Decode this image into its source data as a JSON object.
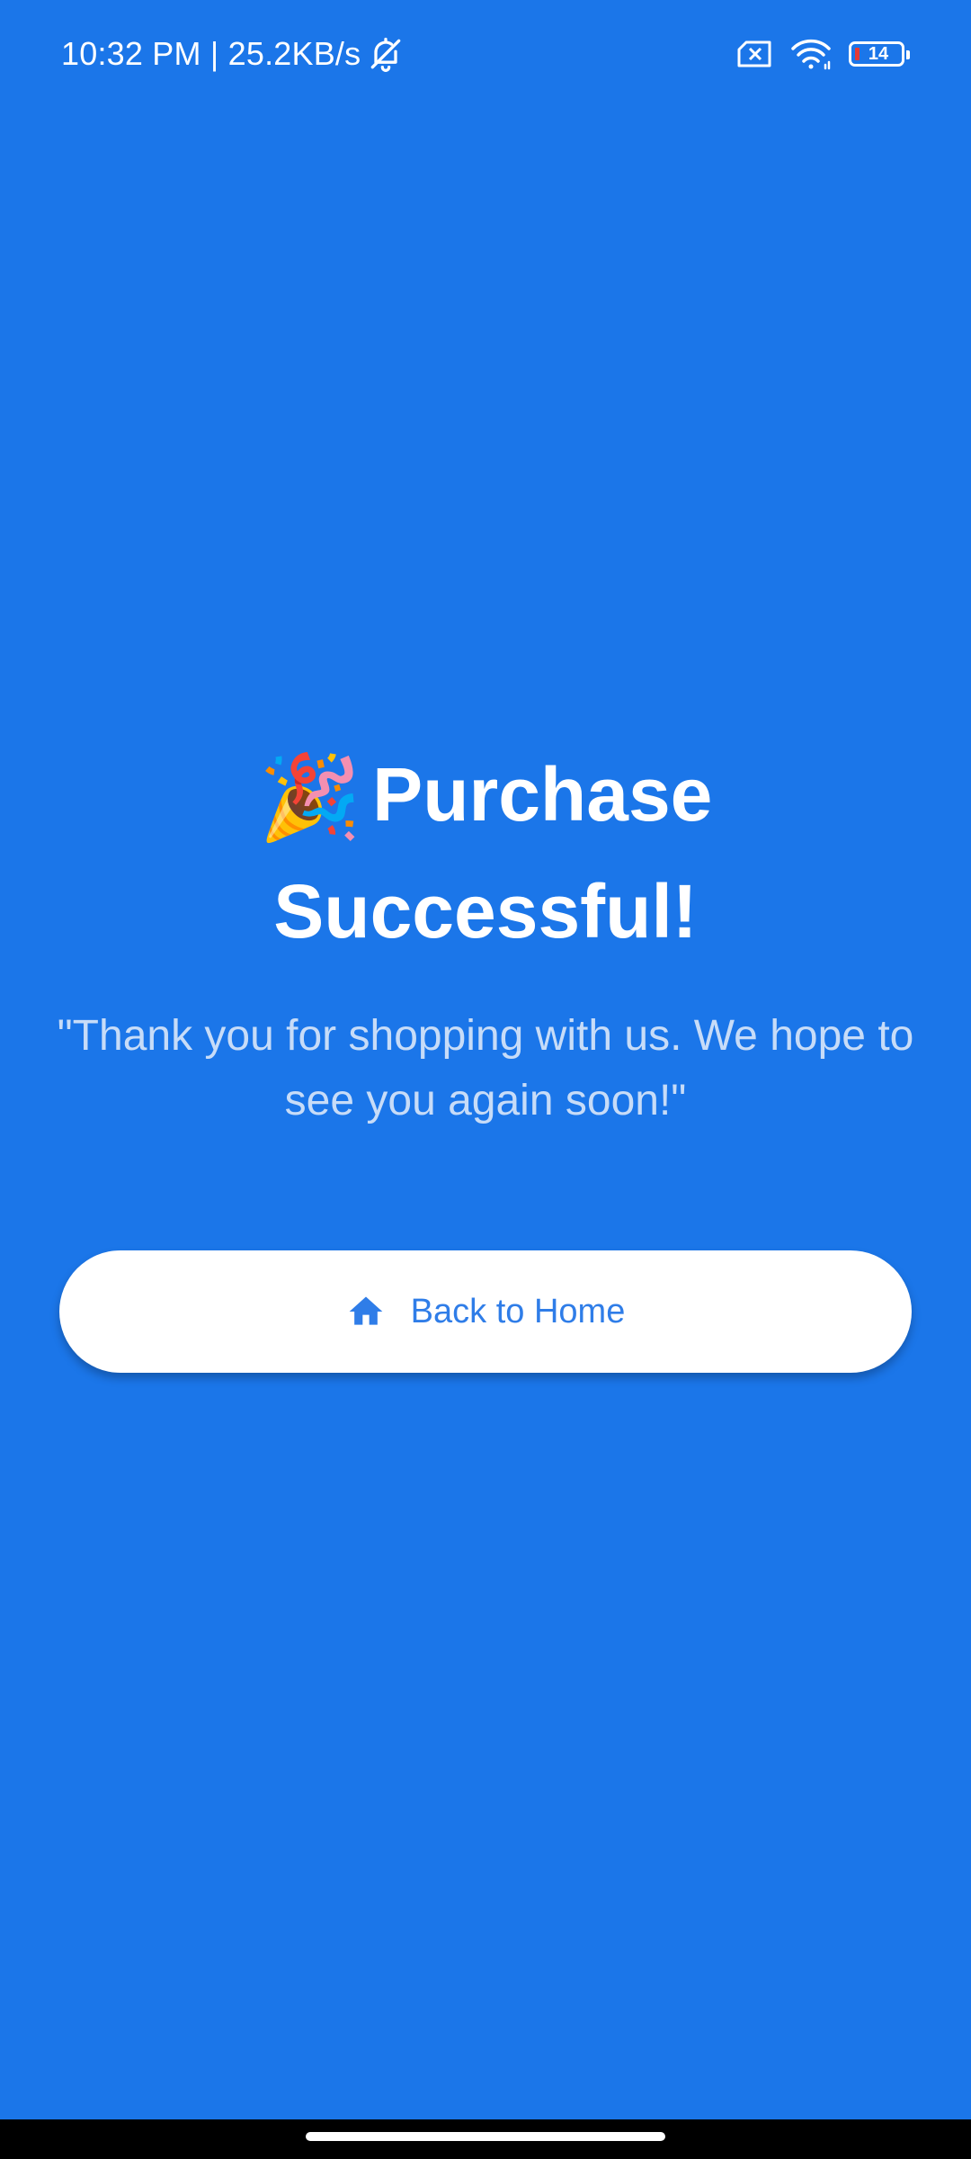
{
  "status_bar": {
    "time_speed": "10:32 PM | 25.2KB/s",
    "battery_level": "14",
    "icons": [
      "bell-off-icon",
      "no-sim-icon",
      "wifi-icon",
      "battery-icon"
    ]
  },
  "main": {
    "emoji": "🎉",
    "headline": "Purchase Successful!",
    "message": "\"Thank you for shopping with us. We hope to see you again soon!\""
  },
  "button": {
    "label": "Back to Home",
    "icon": "home-icon"
  },
  "colors": {
    "background": "#1b76e9",
    "button_text": "#2f7de8",
    "message_text": "#c7dcf8"
  }
}
